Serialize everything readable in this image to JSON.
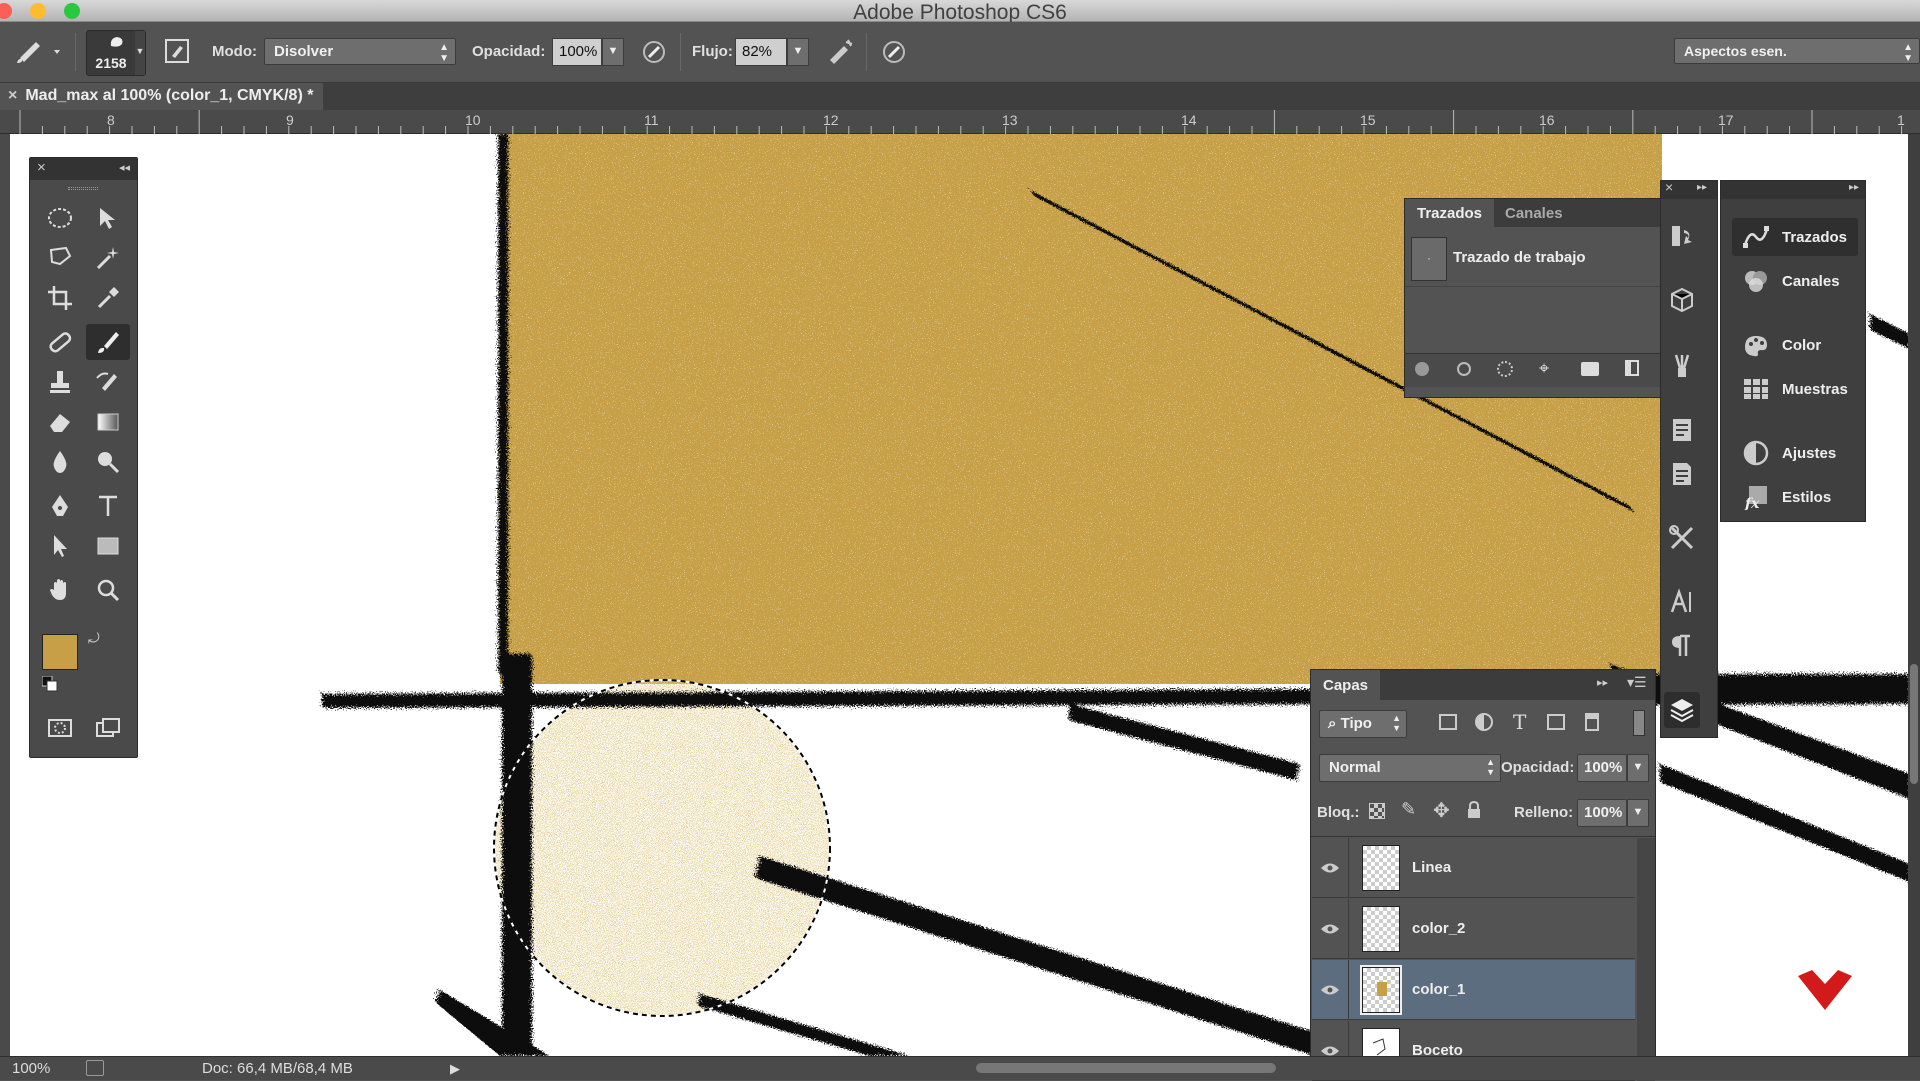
{
  "window": {
    "title": "Adobe Photoshop CS6"
  },
  "options_bar": {
    "brush_size": "2158",
    "mode_label": "Modo:",
    "mode_value": "Disolver",
    "opacity_label": "Opacidad:",
    "opacity_value": "100%",
    "flow_label": "Flujo:",
    "flow_value": "82%",
    "workspace": "Aspectos esen."
  },
  "document": {
    "tab_title": "Mad_max al 100% (color_1, CMYK/8) *",
    "ruler_ticks": [
      "8",
      "9",
      "10",
      "11",
      "12",
      "13",
      "14",
      "15",
      "16",
      "17",
      "1"
    ],
    "foreground_color": "#c69f46",
    "background_color": "#ffffff"
  },
  "paths_panel": {
    "tabs": [
      "Trazados",
      "Canales"
    ],
    "items": [
      {
        "label": "Trazado de trabajo"
      }
    ]
  },
  "dock": {
    "items": [
      {
        "label": "Trazados",
        "icon": "paths-icon"
      },
      {
        "label": "Canales",
        "icon": "channels-icon"
      },
      {
        "label": "Color",
        "icon": "color-icon"
      },
      {
        "label": "Muestras",
        "icon": "swatches-icon"
      },
      {
        "label": "Ajustes",
        "icon": "adjustments-icon"
      },
      {
        "label": "Estilos",
        "icon": "styles-icon"
      }
    ]
  },
  "layers_panel": {
    "title": "Capas",
    "filter_kind": "Tipo",
    "blend_mode": "Normal",
    "opacity_label": "Opacidad:",
    "opacity_value": "100%",
    "lock_label": "Bloq.:",
    "fill_label": "Relleno:",
    "fill_value": "100%",
    "layers": [
      {
        "name": "Linea",
        "visible": true,
        "selected": false
      },
      {
        "name": "color_2",
        "visible": true,
        "selected": false
      },
      {
        "name": "color_1",
        "visible": true,
        "selected": true
      },
      {
        "name": "Boceto",
        "visible": true,
        "selected": false
      }
    ]
  },
  "status": {
    "zoom": "100%",
    "doc_size": "Doc: 66,4 MB/68,4 MB"
  }
}
